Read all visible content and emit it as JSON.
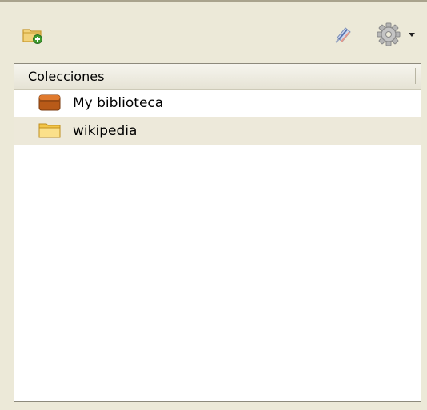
{
  "toolbar": {
    "new_collection": {
      "icon": "new-collection-icon"
    },
    "sync": {
      "icon": "sync-icon"
    },
    "actions": {
      "icon": "gear-icon",
      "dropdown_icon": "chevron-down-icon"
    }
  },
  "collections_pane": {
    "column_header": "Colecciones",
    "items": [
      {
        "label": "My biblioteca",
        "icon": "library-icon",
        "selected": false
      },
      {
        "label": "wikipedia",
        "icon": "folder-icon",
        "selected": true
      }
    ]
  },
  "colors": {
    "background": "#ece9d8",
    "selected_row": "#ede9da",
    "library_icon": "#b85a18",
    "folder_icon": "#f3c547"
  }
}
